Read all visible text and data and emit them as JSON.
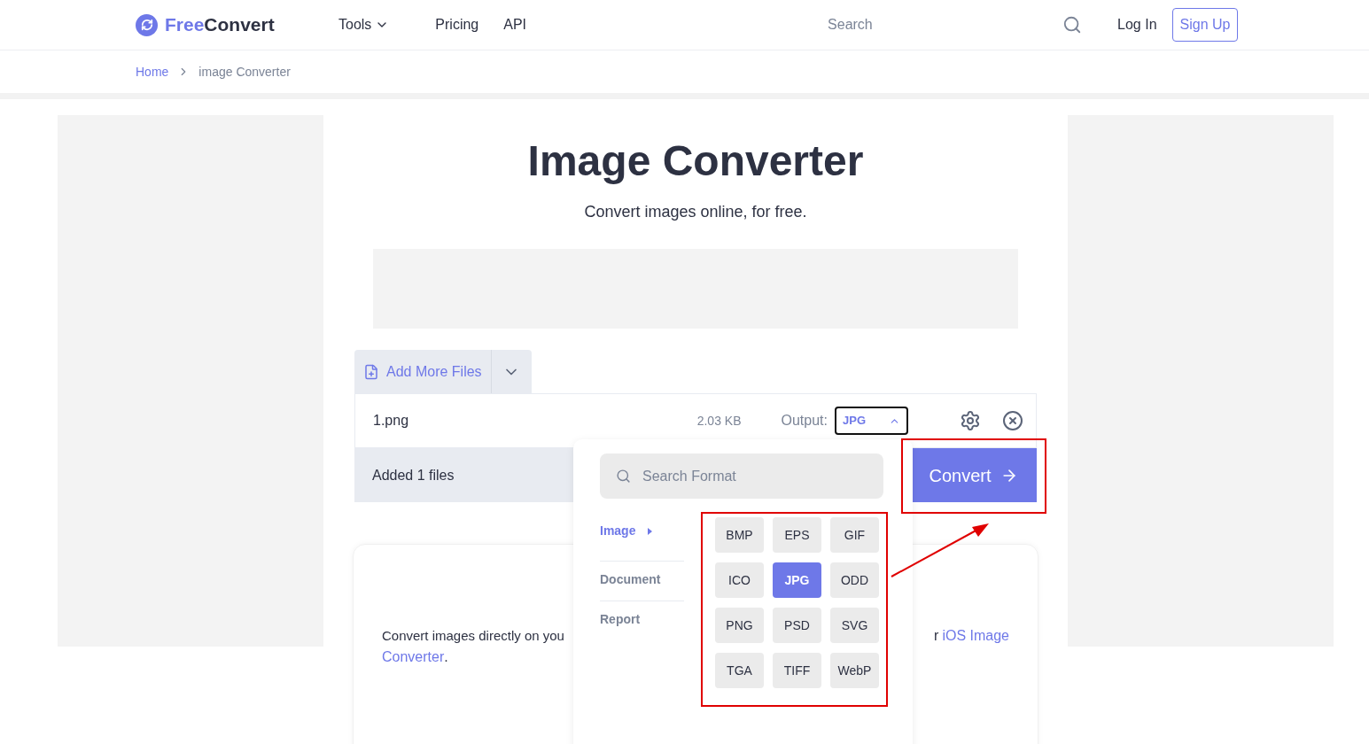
{
  "header": {
    "logo": {
      "part_1": "Free",
      "part_2": "Convert"
    },
    "nav": [
      {
        "label": "Tools",
        "kind": "dropdown"
      },
      {
        "label": "Pricing",
        "kind": "link"
      },
      {
        "label": "API",
        "kind": "link"
      }
    ],
    "search": {
      "placeholder": "Search"
    },
    "login": "Log In",
    "signup": "Sign Up"
  },
  "breadcrumb": [
    "Home",
    "image Converter"
  ],
  "title": "Image Converter",
  "subtitle": "Convert images online, for free.",
  "uploader": {
    "add_button": "Add More Files",
    "file": {
      "name": "1.png",
      "size": "2.03 KB",
      "output_label": "Output:",
      "output_value": "JPG",
      "expanded": true
    },
    "summary": "Added 1 files",
    "convert_button": "Convert"
  },
  "format_menu": {
    "search_placeholder": "Search Format",
    "categories": [
      {
        "label": "Image",
        "selected": true
      },
      {
        "label": "Document",
        "selected": false
      },
      {
        "label": "Report",
        "selected": false
      }
    ],
    "formats": [
      {
        "label": "BMP",
        "selected": false
      },
      {
        "label": "EPS",
        "selected": false
      },
      {
        "label": "GIF",
        "selected": false
      },
      {
        "label": "ICO",
        "selected": false
      },
      {
        "label": "JPG",
        "selected": true
      },
      {
        "label": "ODD",
        "selected": false
      },
      {
        "label": "PNG",
        "selected": false
      },
      {
        "label": "PSD",
        "selected": false
      },
      {
        "label": "SVG",
        "selected": false
      },
      {
        "label": "TGA",
        "selected": false
      },
      {
        "label": "TIFF",
        "selected": false
      },
      {
        "label": "WebP",
        "selected": false
      }
    ]
  },
  "description": {
    "start": "Convert images directly on you",
    "end": "r",
    "link_1": "iOS Image",
    "link_2": "Converter",
    "tail": "."
  }
}
